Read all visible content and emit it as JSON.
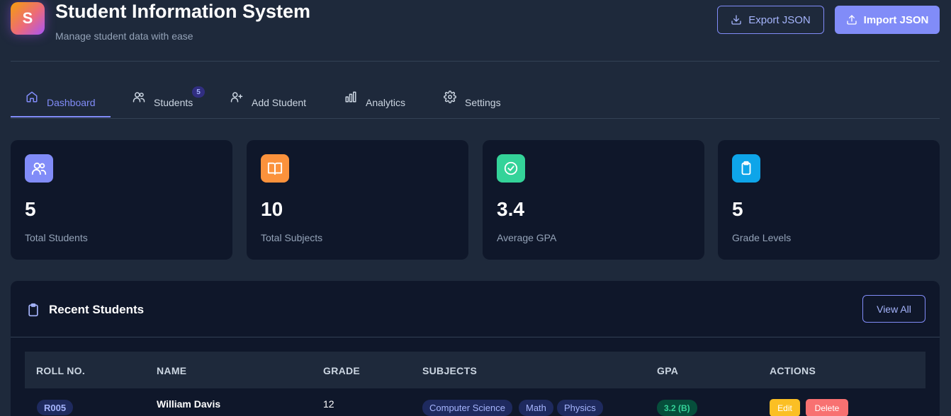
{
  "header": {
    "logo_letter": "S",
    "title": "Student Information System",
    "subtitle": "Manage student data with ease",
    "export_label": "Export JSON",
    "import_label": "Import JSON"
  },
  "tabs": [
    {
      "label": "Dashboard",
      "icon": "home-icon",
      "active": true
    },
    {
      "label": "Students",
      "icon": "users-icon",
      "badge": "5"
    },
    {
      "label": "Add Student",
      "icon": "user-plus-icon"
    },
    {
      "label": "Analytics",
      "icon": "bar-chart-icon"
    },
    {
      "label": "Settings",
      "icon": "gear-icon"
    }
  ],
  "stats": [
    {
      "value": "5",
      "label": "Total Students",
      "icon": "users-icon",
      "color": "#818cf8"
    },
    {
      "value": "10",
      "label": "Total Subjects",
      "icon": "book-icon",
      "color": "#fb923c"
    },
    {
      "value": "3.4",
      "label": "Average GPA",
      "icon": "check-circle-icon",
      "color": "#34d399"
    },
    {
      "value": "5",
      "label": "Grade Levels",
      "icon": "clipboard-icon",
      "color": "#0ea5e9"
    }
  ],
  "recent": {
    "title": "Recent Students",
    "view_all_label": "View All",
    "columns": [
      "ROLL NO.",
      "NAME",
      "GRADE",
      "SUBJECTS",
      "GPA",
      "ACTIONS"
    ],
    "rows": [
      {
        "roll": "R005",
        "name": "William Davis",
        "grade": "12",
        "subjects": [
          "Computer Science",
          "Math",
          "Physics"
        ],
        "gpa": "3.2 (B)",
        "edit_label": "Edit",
        "delete_label": "Delete"
      }
    ]
  }
}
